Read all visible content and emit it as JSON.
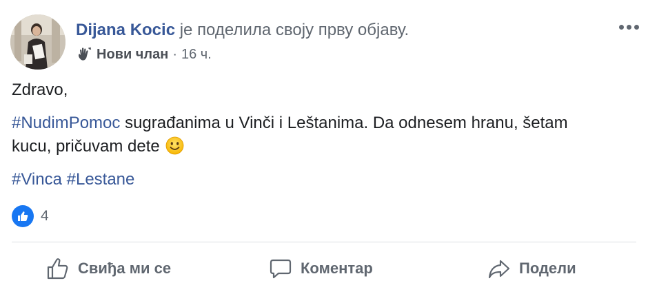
{
  "post": {
    "author_name": "Dijana Kocic",
    "author_action": " је поделила своју прву објаву.",
    "badge_label": "Нови члан",
    "meta_separator": "·",
    "time": "16 ч.",
    "greeting": "Zdravo,",
    "hashtag_main": "#NudimPomoc",
    "body_line2_part1": " sugrađanima u Vinči i Leštanima. Da odnesem hranu, šetam",
    "body_line2_part2": "kucu, pričuvam dete",
    "hashtag_vinca": "#Vinca",
    "hashtag_lestane": "#Lestane",
    "reaction_count": "4"
  },
  "actions": {
    "like_label": "Свиђа ми се",
    "comment_label": "Коментар",
    "share_label": "Подели"
  },
  "icons": {
    "more": "more-horizontal-icon",
    "badge": "wave-hand-icon",
    "emoji": "smiley-emoji-icon",
    "like": "thumbs-up-icon",
    "comment": "comment-bubble-icon",
    "share": "share-arrow-icon"
  },
  "colors": {
    "link": "#385898",
    "secondary_text": "#606770",
    "like_blue": "#1877f2",
    "divider": "#dadde1"
  }
}
